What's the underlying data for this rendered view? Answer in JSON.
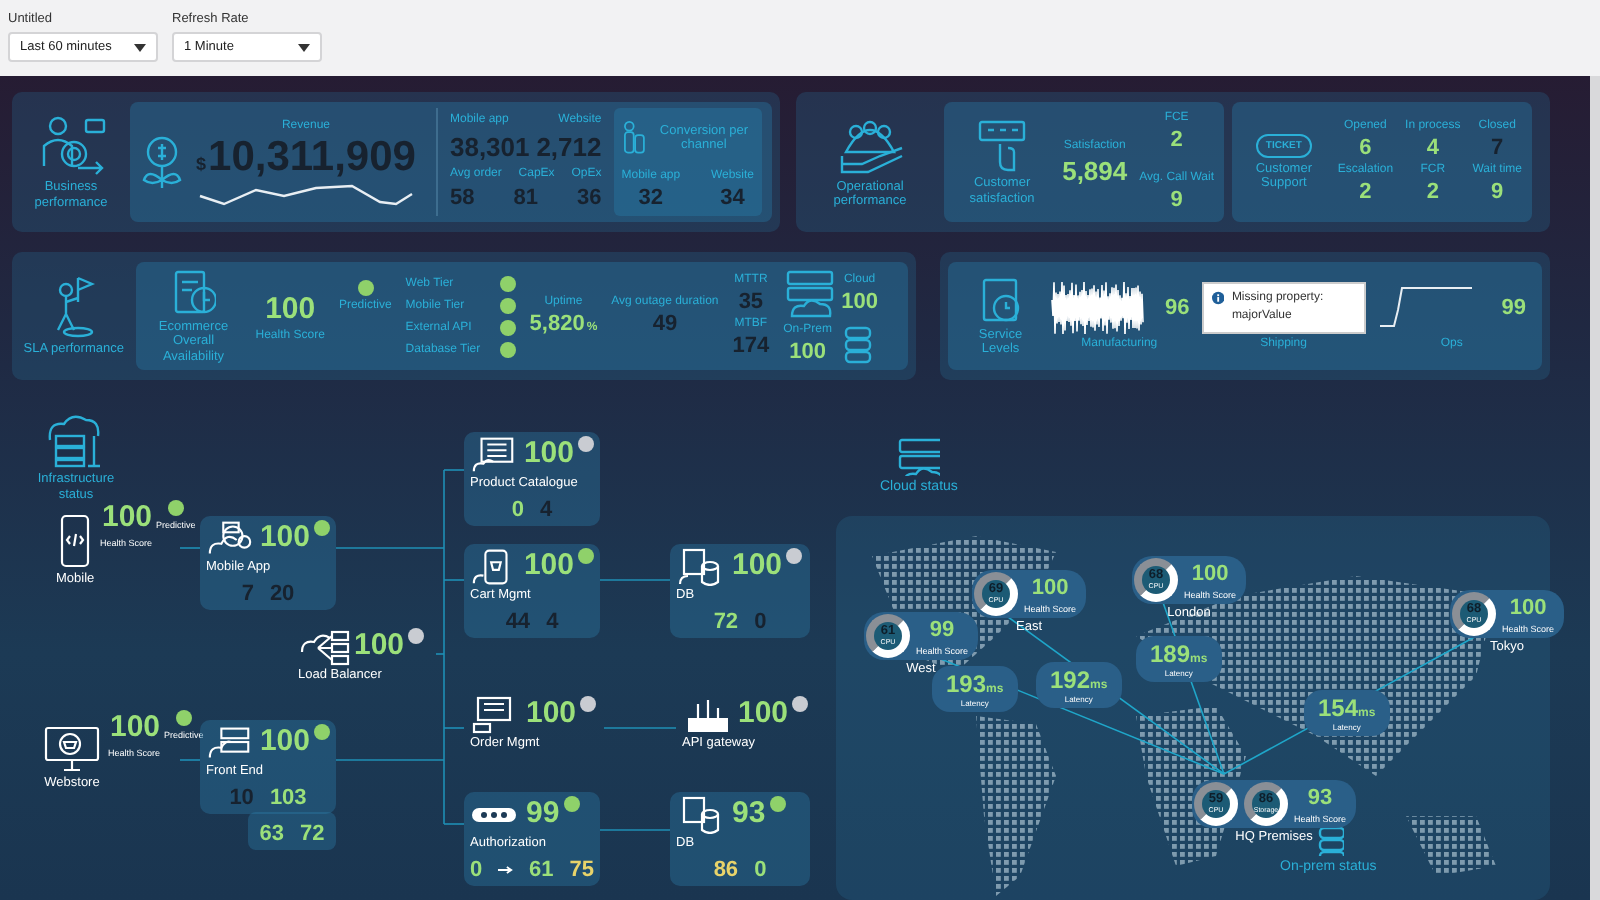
{
  "filters": [
    {
      "label": "Untitled",
      "value": "Last 60 minutes"
    },
    {
      "label": "Refresh Rate",
      "value": "1 Minute"
    }
  ],
  "business": {
    "title": "Business performance",
    "revenue": {
      "label": "Revenue",
      "currency": "$",
      "value": "10,311,909"
    },
    "channels": [
      {
        "label": "Mobile app",
        "value": "38,301"
      },
      {
        "label": "Website",
        "value": "2,712"
      }
    ],
    "costs": [
      {
        "label": "Avg order",
        "value": "58"
      },
      {
        "label": "CapEx",
        "value": "81"
      },
      {
        "label": "OpEx",
        "value": "36"
      }
    ],
    "conversion": {
      "title": "Conversion per channel",
      "items": [
        {
          "label": "Mobile app",
          "value": "32"
        },
        {
          "label": "Website",
          "value": "34"
        }
      ]
    }
  },
  "operational": {
    "title": "Operational performance",
    "satisfaction": {
      "title": "Customer satisfaction",
      "metrics": [
        {
          "label": "Satisfaction",
          "value": "5,894"
        },
        {
          "label": "FCE",
          "value": "2"
        },
        {
          "label": "Avg. Call Wait",
          "value": "9"
        }
      ]
    },
    "support": {
      "title": "Customer Support",
      "badge": "TICKET",
      "metrics": [
        {
          "label": "Opened",
          "value": "6",
          "color": "#9be07a"
        },
        {
          "label": "In process",
          "value": "4",
          "color": "#9be07a"
        },
        {
          "label": "Closed",
          "value": "7",
          "color": "#17222f"
        },
        {
          "label": "Escalation",
          "value": "2",
          "color": "#9be07a"
        },
        {
          "label": "FCR",
          "value": "2",
          "color": "#9be07a"
        },
        {
          "label": "Wait time",
          "value": "9",
          "color": "#9be07a"
        }
      ]
    }
  },
  "sla": {
    "title": "SLA performance",
    "availability": {
      "title": "Ecommerce Overall Availability",
      "score": "100",
      "score_label": "Health Score",
      "predictive": "Predictive",
      "color": "#8fd16a"
    },
    "tiers": [
      {
        "label": "Web Tier",
        "color": "#8fd16a"
      },
      {
        "label": "Mobile Tier",
        "color": "#8fd16a"
      },
      {
        "label": "External API",
        "color": "#8fd16a"
      },
      {
        "label": "Database Tier",
        "color": "#8fd16a"
      }
    ],
    "uptime": {
      "label": "Uptime",
      "value": "5,820",
      "unit": "%"
    },
    "outage": {
      "label": "Avg outage duration",
      "value": "49"
    },
    "mttr": {
      "label": "MTTR",
      "value": "35"
    },
    "mtbf": {
      "label": "MTBF",
      "value": "174"
    },
    "cloud": {
      "label": "Cloud",
      "value": "100"
    },
    "onprem": {
      "label": "On-Prem",
      "value": "100"
    }
  },
  "service_levels": {
    "title": "Service Levels",
    "items": [
      {
        "kind": "wave",
        "label": "Manufacturing",
        "value": "96"
      },
      {
        "kind": "error",
        "label": "Shipping",
        "message": "Missing property: majorValue"
      },
      {
        "kind": "step",
        "label": "Ops",
        "value": "99"
      }
    ]
  },
  "infrastructure": {
    "title": "Infrastructure status",
    "channels": [
      {
        "label": "Mobile",
        "score": "100",
        "score_label": "Health Score",
        "predictive": "Predictive",
        "color": "#8fd16a"
      },
      {
        "label": "Webstore",
        "score": "100",
        "score_label": "Health Score",
        "predictive": "Predictive",
        "color": "#8fd16a"
      }
    ],
    "services": [
      {
        "label": "Mobile App",
        "score": "100",
        "color": "#8fd16a",
        "metrics": [
          {
            "value": "7",
            "color": "#17222f"
          },
          {
            "value": "20",
            "color": "#17222f"
          }
        ]
      },
      {
        "label": "Load Balancer",
        "score": "100",
        "color": "#c9ccd2"
      },
      {
        "label": "Front End",
        "score": "100",
        "color": "#8fd16a",
        "metrics": [
          {
            "value": "10",
            "color": "#17222f"
          },
          {
            "value": "103",
            "color": "#9be07a"
          }
        ],
        "extra_metrics": [
          {
            "value": "63",
            "color": "#9be07a"
          },
          {
            "value": "72",
            "color": "#9be07a"
          }
        ]
      },
      {
        "label": "Product Catalogue",
        "score": "100",
        "color": "#c9ccd2",
        "metrics": [
          {
            "value": "0",
            "color": "#9be07a"
          },
          {
            "value": "4",
            "color": "#17222f"
          }
        ]
      },
      {
        "label": "Cart Mgmt",
        "score": "100",
        "color": "#8fd16a",
        "metrics": [
          {
            "value": "44",
            "color": "#17222f"
          },
          {
            "value": "4",
            "color": "#17222f"
          }
        ]
      },
      {
        "label": "Order Mgmt",
        "score": "100",
        "color": "#c9ccd2"
      },
      {
        "label": "Authorization",
        "score": "99",
        "color": "#8fd16a",
        "metrics": [
          {
            "value": "0",
            "color": "#9be07a",
            "arrow": true
          },
          {
            "value": "61",
            "color": "#9be07a",
            "arrow": false
          },
          {
            "value": "75",
            "color": "#e8d36a",
            "arrow": false
          }
        ]
      },
      {
        "label": "DB",
        "score": "100",
        "color": "#c9ccd2",
        "metrics": [
          {
            "value": "72",
            "color": "#9be07a"
          },
          {
            "value": "0",
            "color": "#17222f"
          }
        ]
      },
      {
        "label": "API gateway",
        "score": "100",
        "color": "#c9ccd2"
      },
      {
        "label": "DB",
        "score": "93",
        "color": "#8fd16a",
        "metrics": [
          {
            "value": "86",
            "color": "#e8d36a"
          },
          {
            "value": "0",
            "color": "#9be07a"
          }
        ]
      }
    ],
    "cloud_title": "Cloud status",
    "onprem_title": "On-prem status",
    "sites": [
      {
        "label": "West",
        "gauges": [
          {
            "value": "61",
            "label": "CPU"
          }
        ],
        "score": "99",
        "score_label": "Health Score"
      },
      {
        "label": "East",
        "gauges": [
          {
            "value": "69",
            "label": "CPU"
          }
        ],
        "score": "100",
        "score_label": "Health Score"
      },
      {
        "label": "London",
        "gauges": [
          {
            "value": "68",
            "label": "CPU"
          }
        ],
        "score": "100",
        "score_label": "Health Score"
      },
      {
        "label": "Tokyo",
        "gauges": [
          {
            "value": "68",
            "label": "CPU"
          }
        ],
        "score": "100",
        "score_label": "Health Score"
      },
      {
        "label": "HQ Premises",
        "gauges": [
          {
            "value": "59",
            "label": "CPU"
          },
          {
            "value": "86",
            "label": "Storage"
          }
        ],
        "score": "93",
        "score_label": "Health Score"
      }
    ],
    "latencies": [
      {
        "value": "193",
        "unit": "ms",
        "label": "Latency"
      },
      {
        "value": "192",
        "unit": "ms",
        "label": "Latency"
      },
      {
        "value": "189",
        "unit": "ms",
        "label": "Latency"
      },
      {
        "value": "154",
        "unit": "ms",
        "label": "Latency"
      }
    ]
  }
}
